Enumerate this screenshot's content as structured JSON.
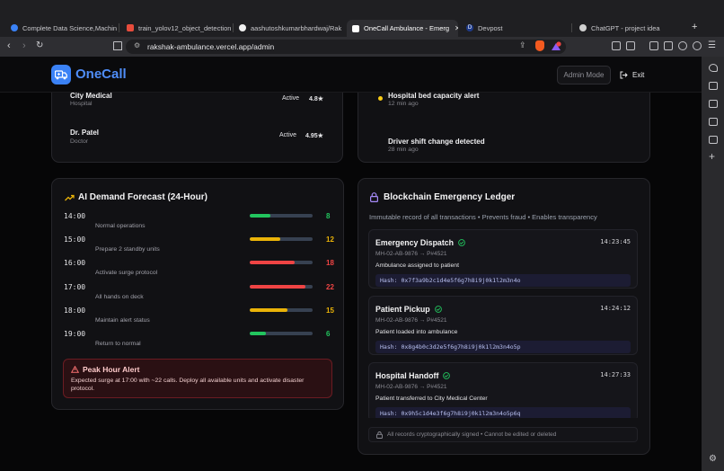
{
  "browser": {
    "tabs": [
      {
        "label": "Complete Data Science,Machine",
        "color": "#3b82f6"
      },
      {
        "label": "train_yolov12_object_detection",
        "color": "#e74c3c"
      },
      {
        "label": "aashutoshkumarbhardwaj/Raksh",
        "color": "#f0f0f0"
      },
      {
        "label": "OneCall Ambulance - Emerg",
        "color": "#ffffff"
      },
      {
        "label": "Devpost",
        "color": "#3b82f6"
      },
      {
        "label": "ChatGPT - project idea",
        "color": "#d0d0d0"
      }
    ],
    "active_tab_index": 3,
    "url": "rakshak-ambulance.vercel.app/admin"
  },
  "header": {
    "brand": "OneCall",
    "admin_mode": "Admin Mode",
    "exit": "Exit"
  },
  "providers": [
    {
      "name": "City Medical",
      "type": "Hospital",
      "status": "Active",
      "rating": "4.8★"
    },
    {
      "name": "Dr. Patel",
      "type": "Doctor",
      "status": "Active",
      "rating": "4.95★"
    }
  ],
  "activity": [
    {
      "text": "Hospital bed capacity alert",
      "time": "12 min ago",
      "dot_color": "#facc15"
    },
    {
      "text": "Driver shift change detected",
      "time": "28 min ago",
      "dot_color": ""
    }
  ],
  "forecast": {
    "title": "AI Demand Forecast (24-Hour)",
    "rows": [
      {
        "time": "14:00",
        "note": "Normal operations",
        "value": "8",
        "fill": 0.33,
        "color": "#22c55e"
      },
      {
        "time": "15:00",
        "note": "Prepare 2 standby units",
        "value": "12",
        "fill": 0.48,
        "color": "#eab308"
      },
      {
        "time": "16:00",
        "note": "Activate surge protocol",
        "value": "18",
        "fill": 0.71,
        "color": "#ef4444"
      },
      {
        "time": "17:00",
        "note": "All hands on deck",
        "value": "22",
        "fill": 0.88,
        "color": "#ef4444"
      },
      {
        "time": "18:00",
        "note": "Maintain alert status",
        "value": "15",
        "fill": 0.6,
        "color": "#eab308"
      },
      {
        "time": "19:00",
        "note": "Return to normal",
        "value": "6",
        "fill": 0.25,
        "color": "#22c55e"
      }
    ],
    "alert": {
      "title": "Peak Hour Alert",
      "text": "Expected surge at 17:00 with ~22 calls. Deploy all available units and activate disaster protocol."
    }
  },
  "ledger": {
    "title": "Blockchain Emergency Ledger",
    "subtitle": "Immutable record of all transactions • Prevents fraud • Enables transparency",
    "entries": [
      {
        "title": "Emergency Dispatch",
        "time": "14:23:45",
        "route": "MH-02-AB-9876 → P#4521",
        "desc": "Ambulance assigned to patient",
        "hash": "Hash: 0x7f3a9b2c1d4e5f6g7h8i9j0k1l2m3n4o"
      },
      {
        "title": "Patient Pickup",
        "time": "14:24:12",
        "route": "MH-02-AB-9876 → P#4521",
        "desc": "Patient loaded into ambulance",
        "hash": "Hash: 0x8g4b0c3d2e5f6g7h8i9j0k1l2m3n4o5p"
      },
      {
        "title": "Hospital Handoff",
        "time": "14:27:33",
        "route": "MH-02-AB-9876 → P#4521",
        "desc": "Patient transferred to City Medical Center",
        "hash": "Hash: 0x9h5c1d4e3f6g7h8i9j0k1l2m3n4o5p6q"
      }
    ],
    "footer": "All records cryptographically signed • Cannot be edited or deleted"
  },
  "colors": {
    "accent": "#3b82f6",
    "success": "#22c55e",
    "warning": "#eab308",
    "danger": "#ef4444",
    "lock": "#a78bfa"
  }
}
